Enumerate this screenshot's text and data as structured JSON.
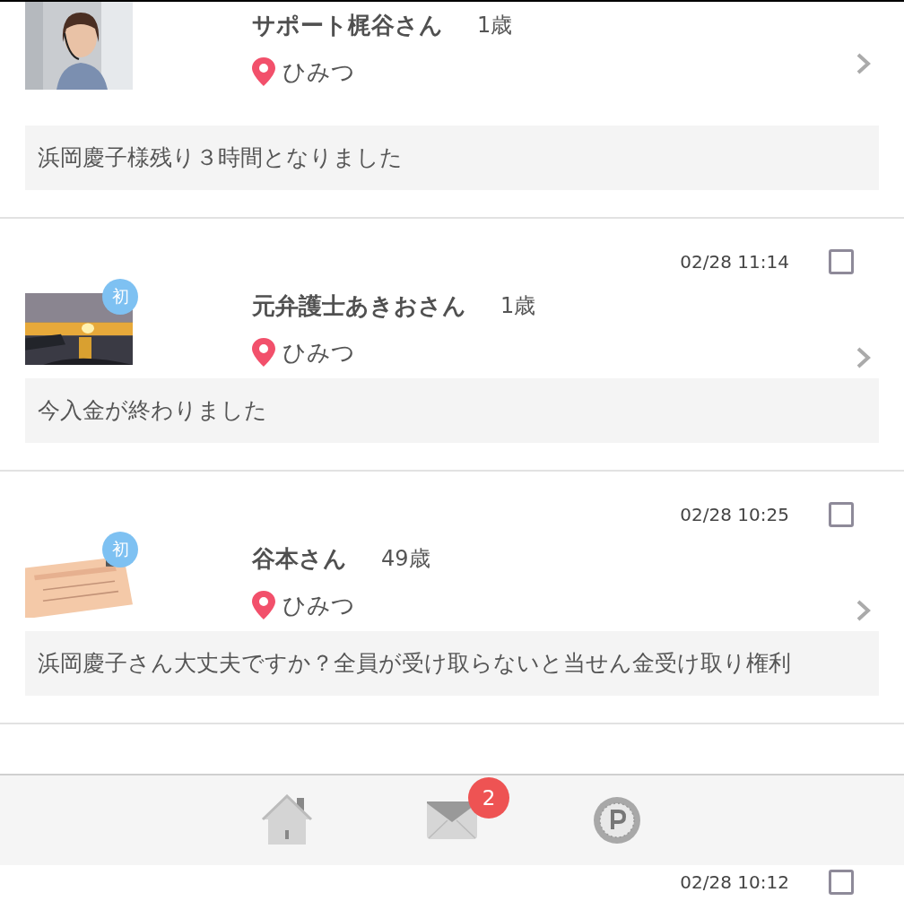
{
  "messages": [
    {
      "name": "サポート梶谷さん",
      "age": "1歳",
      "location": "ひみつ",
      "message": "浜岡慶子様残り３時間となりました"
    },
    {
      "time": "02/28 11:14",
      "checked": false,
      "badge": "初",
      "name": "元弁護士あきおさん",
      "age": "1歳",
      "location": "ひみつ",
      "message": "今入金が終わりました"
    },
    {
      "time": "02/28 10:25",
      "checked": false,
      "badge": "初",
      "name": "谷本さん",
      "age": "49歳",
      "location": "ひみつ",
      "message": "浜岡慶子さん大丈夫ですか？全員が受け取らないと当せん金受け取り権利"
    }
  ],
  "bottom_nav": [
    {
      "kind": "home"
    },
    {
      "kind": "mail",
      "badge": "2"
    },
    {
      "kind": "points"
    }
  ],
  "next_message": {
    "time": "02/28 10:12",
    "checked": false
  }
}
